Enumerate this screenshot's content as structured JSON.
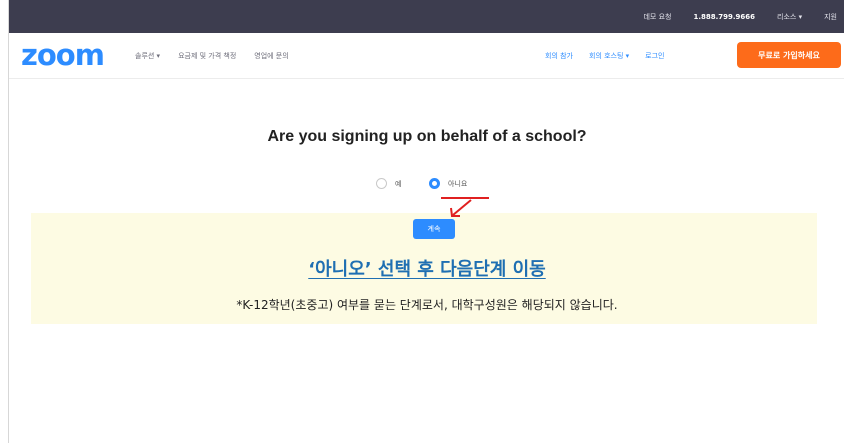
{
  "topbar": {
    "links": [
      "데모 요청",
      "1.888.799.9666",
      "리소스 ▾",
      "지원"
    ]
  },
  "navbar": {
    "logo": "zoom",
    "left_links": [
      "솔루션 ▾",
      "요금제 및 가격 책정",
      "영업에 문의"
    ],
    "right_links": [
      "회의 참가",
      "회의 호스팅 ▾",
      "로그인"
    ],
    "signup_button": "무료로 가입하세요"
  },
  "form": {
    "question": "Are you signing up on behalf of a school?",
    "options": [
      {
        "label": "예",
        "selected": false
      },
      {
        "label": "아니요",
        "selected": true
      }
    ],
    "continue_button": "계속"
  },
  "annotation": {
    "instruction": "‘아니오’ 선택 후 다음단계 이동",
    "note": "*K-12학년(초중고) 여부를 묻는 단계로서, 대학구성원은 해당되지 않습니다."
  },
  "colors": {
    "accent": "#2d8cff",
    "signup": "#fd6b1a",
    "annotation_red": "#e02020",
    "highlight_bg": "#fdfbe3",
    "instruction_text": "#1f6fb2"
  }
}
